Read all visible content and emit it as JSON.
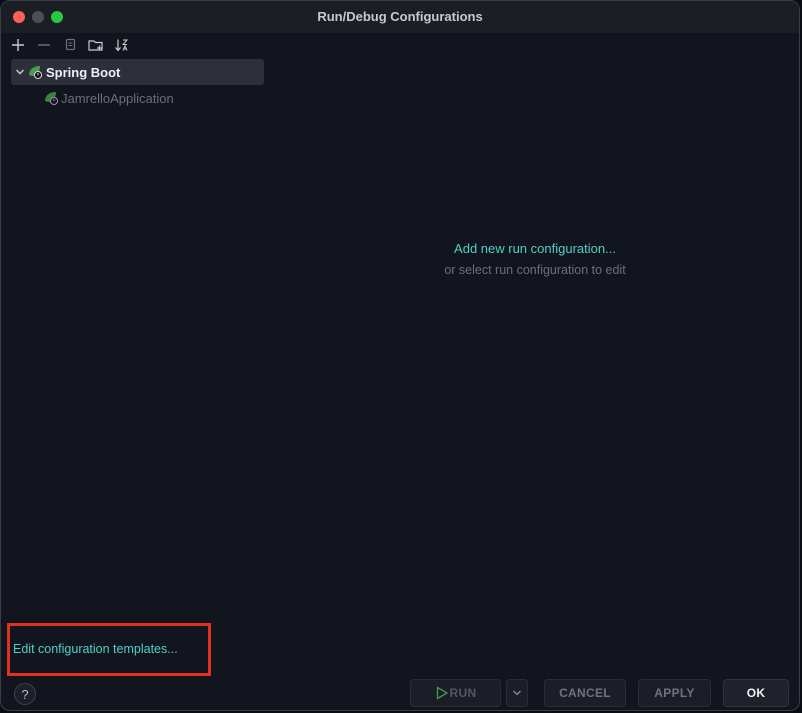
{
  "window": {
    "title": "Run/Debug Configurations"
  },
  "toolbar": {
    "icons": [
      "plus-icon",
      "minus-icon",
      "copy-icon",
      "folder-add-icon",
      "sort-alpha-icon"
    ]
  },
  "tree": {
    "root": {
      "label": "Spring Boot",
      "icon": "spring-boot-icon",
      "expanded": true
    },
    "children": [
      {
        "label": "JamrelloApplication",
        "icon": "spring-boot-icon"
      }
    ]
  },
  "empty_state": {
    "add_link": "Add new run configuration...",
    "hint": "or select run configuration to edit"
  },
  "templates_link": "Edit configuration templates...",
  "footer": {
    "help": "?",
    "run": "RUN",
    "cancel": "CANCEL",
    "apply": "APPLY",
    "ok": "OK"
  },
  "colors": {
    "accent_link": "#4fd1c5",
    "highlight_box": "#e0321f",
    "window_bg": "#12151d",
    "selection_bg": "#2d303b"
  }
}
